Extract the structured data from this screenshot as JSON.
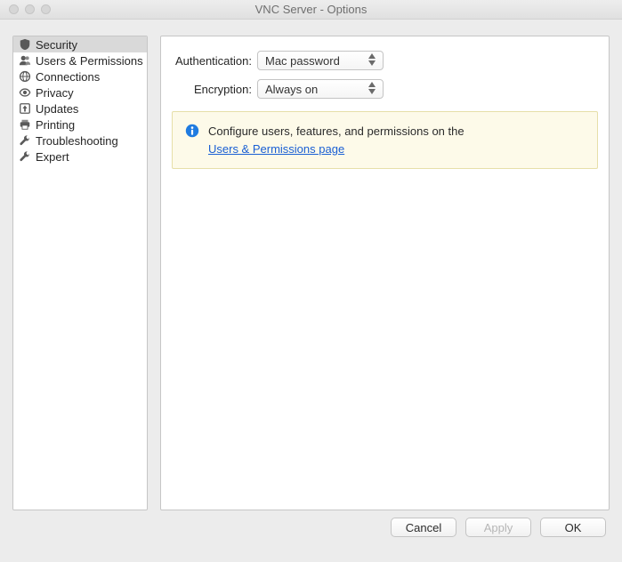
{
  "window": {
    "title": "VNC Server - Options"
  },
  "sidebar": {
    "items": [
      {
        "label": "Security",
        "icon": "shield-icon",
        "selected": true
      },
      {
        "label": "Users & Permissions",
        "icon": "users-icon",
        "selected": false
      },
      {
        "label": "Connections",
        "icon": "globe-icon",
        "selected": false
      },
      {
        "label": "Privacy",
        "icon": "eye-icon",
        "selected": false
      },
      {
        "label": "Updates",
        "icon": "arrow-up-box-icon",
        "selected": false
      },
      {
        "label": "Printing",
        "icon": "printer-icon",
        "selected": false
      },
      {
        "label": "Troubleshooting",
        "icon": "wrench-icon",
        "selected": false
      },
      {
        "label": "Expert",
        "icon": "wrench-icon",
        "selected": false
      }
    ]
  },
  "form": {
    "authentication": {
      "label": "Authentication:",
      "value": "Mac password"
    },
    "encryption": {
      "label": "Encryption:",
      "value": "Always on"
    }
  },
  "info": {
    "text": "Configure users, features, and permissions on the",
    "link": "Users & Permissions page"
  },
  "buttons": {
    "cancel": "Cancel",
    "apply": "Apply",
    "ok": "OK"
  }
}
